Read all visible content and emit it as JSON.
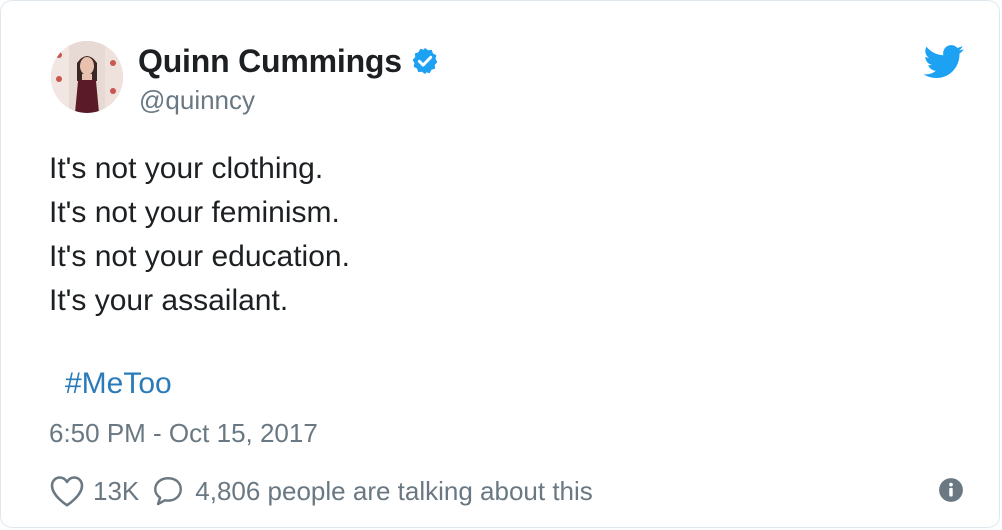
{
  "author": {
    "display_name": "Quinn Cummings",
    "handle": "@quinncy",
    "verified": true,
    "avatar_icon": "profile-photo"
  },
  "tweet": {
    "lines": [
      "It's not your clothing.",
      "It's not your feminism.",
      "It's not your education.",
      "It's your assailant."
    ],
    "hashtag": "#MeToo",
    "timestamp": "6:50 PM - Oct 15, 2017"
  },
  "actions": {
    "likes_count": "13K",
    "talking_text": "4,806 people are talking about this",
    "like_icon": "heart-icon",
    "reply_icon": "speech-bubble-icon",
    "info_icon": "info-icon"
  },
  "brand": {
    "logo_icon": "twitter-bird-icon",
    "twitter_blue": "#1da1f2",
    "link_color": "#2b7bb9",
    "text_color": "#1c2022",
    "secondary_color": "#697882"
  }
}
